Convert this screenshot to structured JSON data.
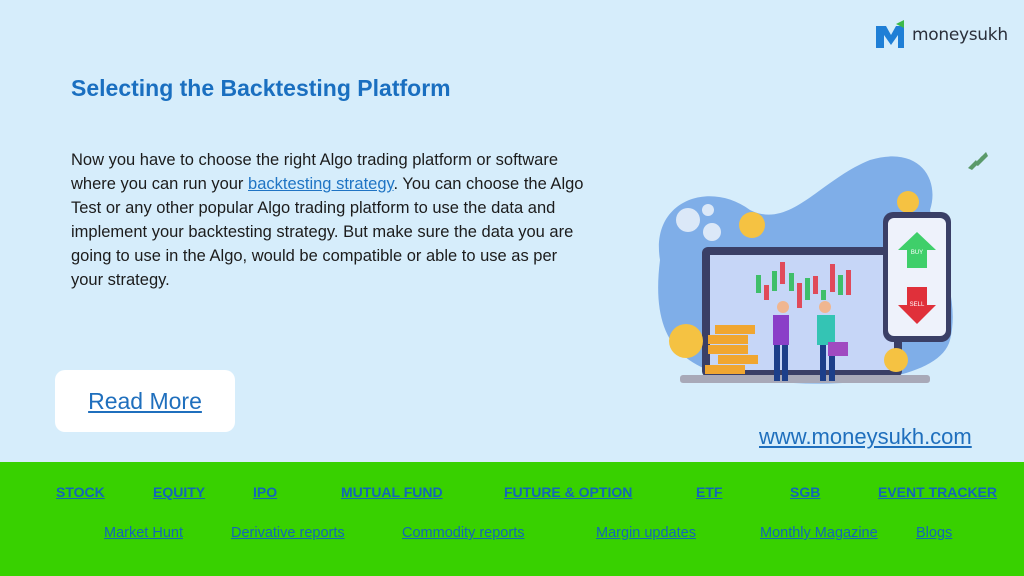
{
  "brand": {
    "name": "moneysukh",
    "logo_icon": "m-logo-arrow-icon",
    "primary_color": "#1a6fc0",
    "footer_color": "#38d100"
  },
  "page": {
    "title": "Selecting the Backtesting Platform",
    "paragraph_before_link": "Now you have to choose the right Algo trading platform or software where you can run your ",
    "link_text": "backtesting strategy",
    "paragraph_after_link": ". You can choose the Algo Test or any other popular Algo trading platform to use the data and implement your backtesting strategy. But make sure the data you are going to use in the Algo, would be compatible or able to use as per your strategy.",
    "read_more_label": "Read More",
    "site_url": "www.moneysukh.com"
  },
  "illustration": {
    "description": "two people shaking hands in front of laptop with candlestick chart, phone with BUY and SELL arrows, rupee coins and gears",
    "buy_label": "BUY",
    "sell_label": "SELL",
    "coin_symbol": "₹"
  },
  "footer": {
    "primary_links": [
      "STOCK",
      "EQUITY",
      "IPO",
      "MUTUAL FUND",
      "FUTURE & OPTION",
      "ETF",
      "SGB",
      "EVENT TRACKER"
    ],
    "secondary_links": [
      "Market Hunt",
      "Derivative reports",
      "Commodity reports",
      "Margin updates",
      "Monthly Magazine",
      "Blogs"
    ]
  }
}
